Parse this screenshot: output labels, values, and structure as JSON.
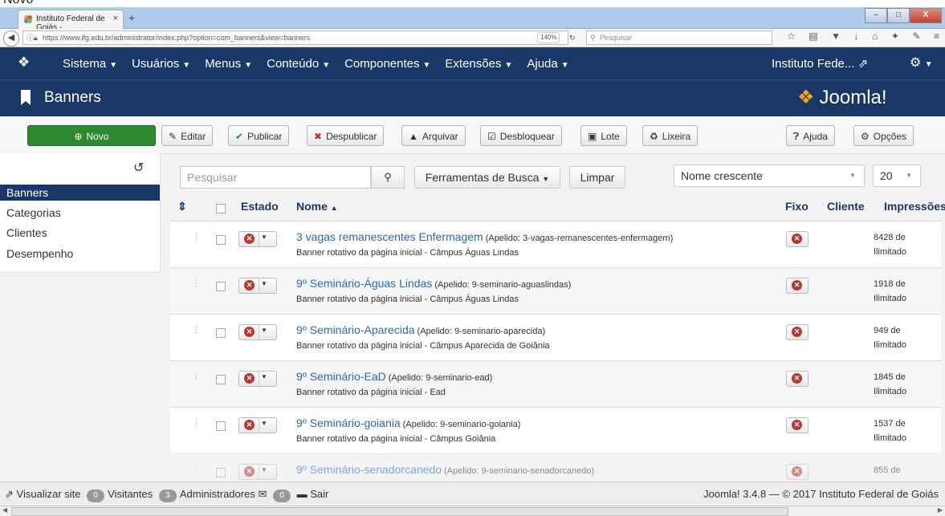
{
  "caption": {
    "text": "Novo"
  },
  "browser": {
    "tab_title": "Instituto Federal de Goiás -...",
    "tab_close": "×",
    "new_tab": "+",
    "url": "https://www.ifg.edu.br/administrator/index.php?option=com_banners&view=banners",
    "zoom": "140%",
    "search_placeholder": "Pesquisar",
    "window_controls": [
      "–",
      "□",
      "X"
    ]
  },
  "jnav": {
    "menu": [
      "Sistema",
      "Usuários",
      "Menus",
      "Conteúdo",
      "Componentes",
      "Extensões",
      "Ajuda"
    ],
    "site": "Instituto Fede..."
  },
  "header": {
    "title": "Banners",
    "brand": "Joomla!"
  },
  "toolbar": {
    "novo": "Novo",
    "editar": "Editar",
    "publicar": "Publicar",
    "despublicar": "Despublicar",
    "arquivar": "Arquivar",
    "desbloquear": "Desbloquear",
    "lote": "Lote",
    "lixeira": "Lixeira",
    "ajuda": "Ajuda",
    "opcoes": "Opções"
  },
  "sidebar": {
    "items": [
      "Banners",
      "Categorias",
      "Clientes",
      "Desempenho"
    ],
    "active": "Banners"
  },
  "filters": {
    "search_placeholder": "Pesquisar",
    "tools": "Ferramentas de Busca",
    "clear": "Limpar",
    "ordering": "Nome crescente",
    "limit": "20"
  },
  "table": {
    "headers": {
      "estado": "Estado",
      "nome": "Nome",
      "fixo": "Fixo",
      "cliente": "Cliente",
      "impressoes": "Impressões"
    },
    "rows": [
      {
        "name": "3 vagas remanescentes Enfermagem",
        "alias": "(Apelido: 3-vagas-remanescentes-enfermagem)",
        "category": "Banner rotativo da página inicial - Câmpus Águas Lindas",
        "imp_count": "8428 de",
        "imp_limit": "Ilimitado"
      },
      {
        "name": "9º Seminário-Águas Lindas",
        "alias": "(Apelido: 9-seminario-aguaslindas)",
        "category": "Banner rotativo da página inicial - Câmpus Águas Lindas",
        "imp_count": "1918 de",
        "imp_limit": "Ilimitado"
      },
      {
        "name": "9º Seminário-Aparecida",
        "alias": "(Apelido: 9-seminario-aparecida)",
        "category": "Banner rotativo da página inicial - Câmpus Aparecida de Goiânia",
        "imp_count": "949 de",
        "imp_limit": "Ilimitado"
      },
      {
        "name": "9º Seminário-EaD",
        "alias": "(Apelido: 9-seminario-ead)",
        "category": "Banner rotativo da página inicial - Ead",
        "imp_count": "1845 de",
        "imp_limit": "Ilimitado"
      },
      {
        "name": "9º Seminário-goiania",
        "alias": "(Apelido: 9-seminario-goiania)",
        "category": "Banner rotativo da página inicial - Câmpus Goiânia",
        "imp_count": "1537 de",
        "imp_limit": "Ilimitado"
      },
      {
        "name": "9º Seminário-senadorcanedo",
        "alias": "(Apelido: 9-seminario-senadorcanedo)",
        "category": "",
        "imp_count": "855 de",
        "imp_limit": ""
      }
    ]
  },
  "status": {
    "view_site": "Visualizar site",
    "visitors_count": "0",
    "visitors": "Visitantes",
    "admins_count": "3",
    "admins": "Administradores",
    "messages_count": "0",
    "logout": "Sair",
    "footer": "Joomla! 3.4.8 — © 2017 Instituto Federal de Goiás"
  },
  "colors": {
    "nav": "#1a3867",
    "primary_green": "#2f8a2f",
    "link": "#2a69b8",
    "unpublished": "#bd362f"
  }
}
